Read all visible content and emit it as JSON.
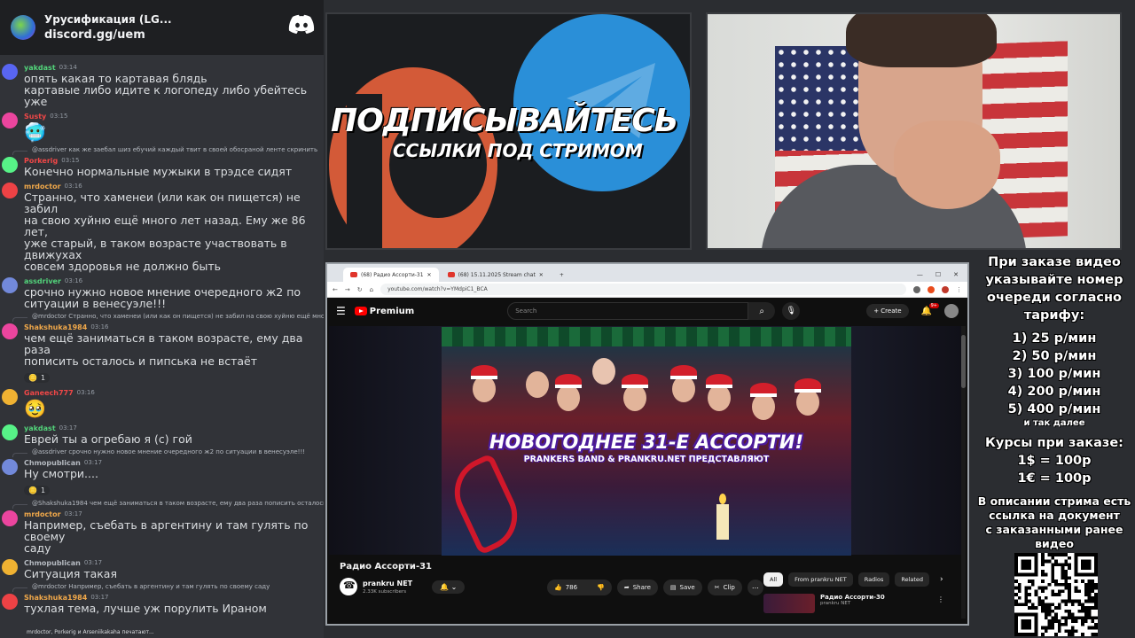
{
  "discord": {
    "server_name": "Урусификация (LG...",
    "invite": "discord.gg/uem",
    "typing": "mrdoctor, Porkerig и Arseniikakaha печатают...",
    "messages": [
      {
        "kind": "msg",
        "name": "yakdast",
        "name_color": "#52d37a",
        "time": "03:14",
        "lines": [
          "опять какая то картавая блядь",
          "картавые либо идите к логопеду либо убейтесь уже"
        ]
      },
      {
        "kind": "msg",
        "name": "Susty",
        "name_color": "#f04747",
        "time": "03:15",
        "emoji": "🥶"
      },
      {
        "kind": "reply",
        "text": "@assdriver как же заебал шиз ебучий каждый твит в своей обосраной ленте скринить"
      },
      {
        "kind": "msg",
        "name": "Porkerig",
        "name_color": "#f04747",
        "time": "03:15",
        "lines": [
          "Конечно нормальные мужыки в трэдсе сидят"
        ]
      },
      {
        "kind": "msg",
        "name": "mrdoctor",
        "name_color": "#f0a84a",
        "time": "03:16",
        "lines": [
          "Странно, что хаменеи (или как он пищется) не забил",
          "на свою хуйню ещё много лет назад. Ему же 86 лет,",
          "уже старый, в таком возрасте участвовать в движухах",
          "совсем здоровья не должно быть"
        ]
      },
      {
        "kind": "msg",
        "name": "assdriver",
        "name_color": "#52d37a",
        "time": "03:16",
        "lines": [
          "срочно нужно новое мнение очередного ж2 по",
          "ситуации в венесуэле!!!"
        ]
      },
      {
        "kind": "reply",
        "text": "@mrdoctor Странно, что хаменеи (или как он пищется) не забил на свою хуйню ещё много лет на"
      },
      {
        "kind": "msg",
        "name": "Shakshuka1984",
        "name_color": "#f0a84a",
        "time": "03:16",
        "lines": [
          "чем ещё заниматься в таком возрасте, ему два раза",
          "пописить осталось и пипська не встаёт"
        ],
        "reaction": "1"
      },
      {
        "kind": "msg",
        "name": "Ganeech777",
        "name_color": "#f04747",
        "time": "03:16",
        "emoji": "🥹"
      },
      {
        "kind": "msg",
        "name": "yakdast",
        "name_color": "#52d37a",
        "time": "03:17",
        "lines": [
          "Еврей ты а огребаю я (с) гой"
        ]
      },
      {
        "kind": "reply",
        "text": "@assdriver срочно нужно новое мнение очередного ж2 по ситуации в венесуэле!!!"
      },
      {
        "kind": "msg",
        "name": "Chmopublican",
        "name_color": "#b5bac1",
        "time": "03:17",
        "lines": [
          "Ну смотри...."
        ],
        "reaction": "1"
      },
      {
        "kind": "reply",
        "text": "@Shakshuka1984 чем ещё заниматься в таком возрасте, ему два раза пописить осталось и пипськ"
      },
      {
        "kind": "msg",
        "name": "mrdoctor",
        "name_color": "#f0a84a",
        "time": "03:17",
        "lines": [
          "Например, съебать в аргентину и там гулять по своему",
          "саду"
        ]
      },
      {
        "kind": "msg",
        "name": "Chmopublican",
        "name_color": "#b5bac1",
        "time": "03:17",
        "lines": [
          "Ситуация такая"
        ]
      },
      {
        "kind": "reply",
        "text": "@mrdoctor Например, съебать в аргентину и там гулять по своему саду"
      },
      {
        "kind": "msg",
        "name": "Shakshuka1984",
        "name_color": "#f0a84a",
        "time": "03:17",
        "lines": [
          "тухлая тема, лучше уж порулить Ираном"
        ]
      }
    ]
  },
  "banner": {
    "title": "ПОДПИСЫВАЙТЕСЬ",
    "subtitle": "ССЫЛКИ ПОД СТРИМОМ"
  },
  "browser": {
    "tab1": "(68) Радио Ассорти-31",
    "tab2": "(68) 15.11.2025 Stream chat",
    "url": "youtube.com/watch?v=YMdpiC1_BCA",
    "logo": "Premium",
    "search_placeholder": "Search",
    "create": "Create",
    "notif_badge": "9+",
    "thumb_title": "НОВОГОДНЕЕ 31-Е АССОРТИ!",
    "thumb_sub": "PRANKERS BAND & PRANKRU.NET ПРЕДСТАВЛЯЮТ",
    "video_title": "Радио Ассорти-31",
    "channel": "prankru NET",
    "subs": "2.33K subscribers",
    "likes": "786",
    "share": "Share",
    "save": "Save",
    "clip": "Clip",
    "chips": [
      "All",
      "From prankru NET",
      "Radios",
      "Related"
    ],
    "rec_title": "Радио Ассорти-30",
    "rec_channel": "prankru NET"
  },
  "info": {
    "l1": "При заказе видео",
    "l2": "указывайте номер",
    "l3": "очереди согласно",
    "l4": "тарифу:",
    "p1": "1) 25 р/мин",
    "p2": "2) 50 р/мин",
    "p3": "3) 100 р/мин",
    "p4": "4) 200 р/мин",
    "p5": "5) 400 р/мин",
    "etc": "и так далее",
    "c1": "Курсы при заказе:",
    "c2": "1$ = 100р",
    "c3": "1€ = 100р",
    "d1": "В описании стрима есть",
    "d2": "ссылка на документ",
    "d3": "с заказанными ранее",
    "d4": "видео"
  }
}
